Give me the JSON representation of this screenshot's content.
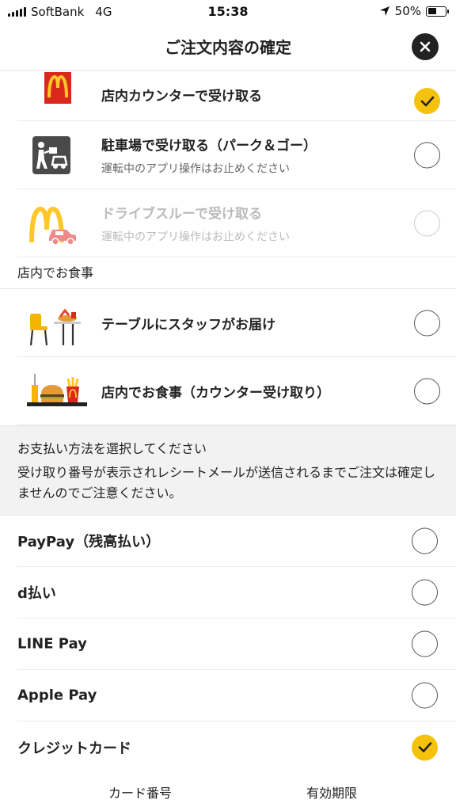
{
  "status_bar": {
    "carrier": "SoftBank",
    "network": "4G",
    "time": "15:38",
    "battery": "50%",
    "battery_level": 0.5
  },
  "header": {
    "title": "ご注文内容の確定",
    "close_icon": "close-icon"
  },
  "pickup_options": [
    {
      "label": "店内カウンターで受け取る",
      "sub": "",
      "checked": true,
      "disabled": false,
      "icon": "mcdonalds-bag-icon"
    },
    {
      "label": "駐車場で受け取る（パーク＆ゴー）",
      "sub": "運転中のアプリ操作はお止めください",
      "checked": false,
      "disabled": false,
      "icon": "park-and-go-icon"
    },
    {
      "label": "ドライブスルーで受け取る",
      "sub": "運転中のアプリ操作はお止めください",
      "checked": false,
      "disabled": true,
      "icon": "drive-thru-icon"
    }
  ],
  "dine_in": {
    "section_title": "店内でお食事",
    "options": [
      {
        "label": "テーブルにスタッフがお届け",
        "checked": false,
        "icon": "table-delivery-icon"
      },
      {
        "label": "店内でお食事（カウンター受け取り）",
        "checked": false,
        "icon": "counter-meal-icon"
      }
    ]
  },
  "payment": {
    "notice_line1": "お支払い方法を選択してください",
    "notice_line2": "受け取り番号が表示されレシートメールが送信されるまでご注文は確定しませんのでご注意ください。",
    "methods": [
      {
        "label": "PayPay（残高払い）",
        "checked": false
      },
      {
        "label": "d払い",
        "checked": false
      },
      {
        "label": "LINE Pay",
        "checked": false
      },
      {
        "label": "Apple Pay",
        "checked": false
      },
      {
        "label": "クレジットカード",
        "checked": true
      }
    ],
    "card_number_label": "カード番号",
    "expiry_label": "有効期限"
  },
  "colors": {
    "accent": "#f5c20b",
    "mcd_red": "#da291c",
    "mcd_yellow": "#ffc72c"
  }
}
